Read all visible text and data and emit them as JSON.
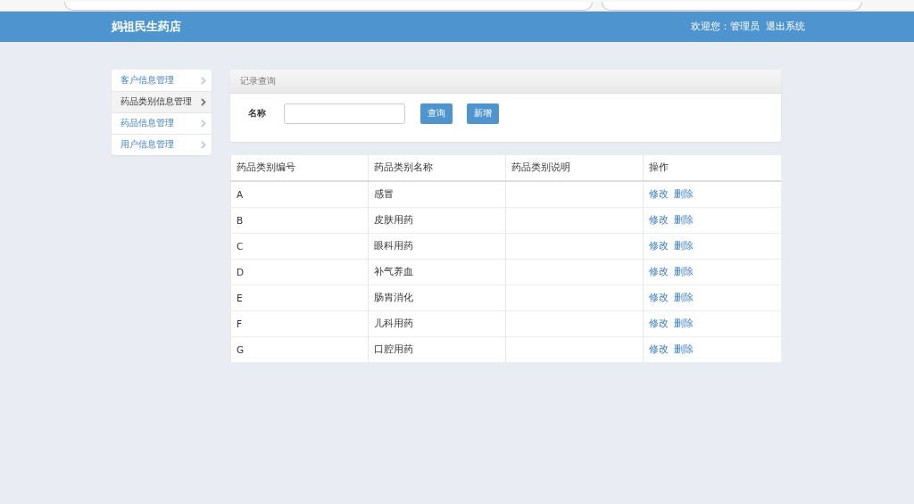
{
  "header": {
    "brand": "妈祖民生药店",
    "welcome": "欢迎您：",
    "user": "管理员",
    "logout": "退出系统"
  },
  "sidebar": {
    "items": [
      {
        "label": "客户信息管理",
        "selected": false
      },
      {
        "label": "药品类别信息管理",
        "selected": true
      },
      {
        "label": "药品信息管理",
        "selected": false
      },
      {
        "label": "用户信息管理",
        "selected": false
      }
    ]
  },
  "query_panel": {
    "title": "记录查询",
    "field_label": "名称",
    "buttons": [
      "查询",
      "新增"
    ]
  },
  "table": {
    "columns": [
      "药品类别编号",
      "药品类别名称",
      "药品类别说明",
      "操作"
    ],
    "rows": [
      {
        "code": "A",
        "name": "感冒",
        "actions": [
          "修改",
          "删除"
        ]
      },
      {
        "code": "B",
        "name": "皮肤用药",
        "actions": [
          "修改",
          "删除"
        ]
      },
      {
        "code": "C",
        "name": "眼科用药",
        "actions": [
          "修改",
          "删除"
        ]
      },
      {
        "code": "D",
        "name": "补气养血",
        "actions": [
          "修改",
          "删除"
        ]
      },
      {
        "code": "E",
        "name": "肠胃消化",
        "actions": [
          "修改",
          "删除"
        ]
      },
      {
        "code": "F",
        "name": "儿科用药",
        "actions": [
          "修改",
          "删除"
        ]
      },
      {
        "code": "G",
        "name": "口腔用药",
        "actions": [
          "修改",
          "删除"
        ]
      }
    ]
  }
}
